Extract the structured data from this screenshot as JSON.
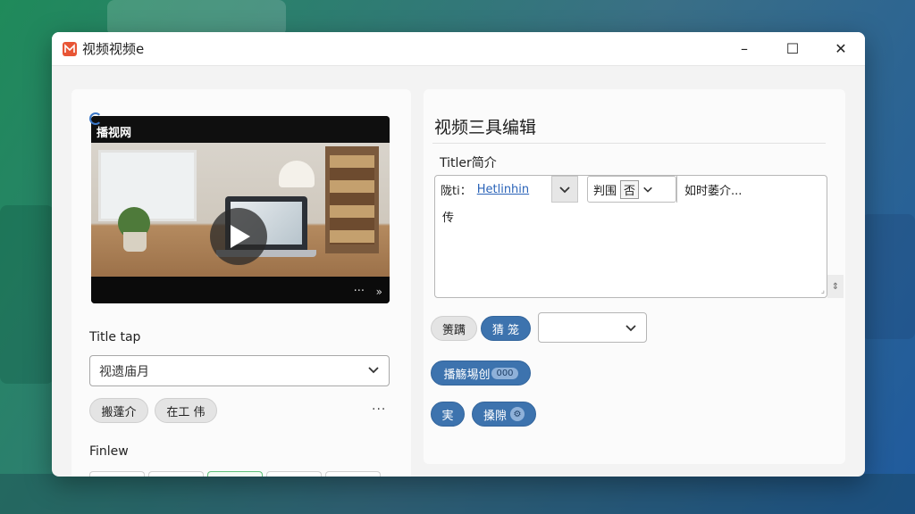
{
  "window": {
    "title": "视频视频e",
    "minimize": "–",
    "maximize": "☐",
    "close": "✕"
  },
  "left": {
    "video": {
      "title": "播视网",
      "more": "···",
      "expand": "»"
    },
    "title_tap_label": "Title tap",
    "dropdown": {
      "value": "视遗庙月"
    },
    "chips": [
      "搬蓬介",
      "在工 伟"
    ],
    "more": "···",
    "finlew_label": "Finlew"
  },
  "right": {
    "heading": "视频三具编辑",
    "titler_label": "Titler简介",
    "editor": {
      "seg1_prefix": "陇ti：",
      "seg1_link": "Hetlinhin",
      "seg2_text": "判围",
      "seg2_box": "否",
      "seg3_text": "如时萎介...",
      "body": "传"
    },
    "buttons": {
      "row1_a": "箦蹒",
      "row1_b": "猜 笼",
      "row2": "播觞埸创",
      "row2_badge": "000",
      "row3_a": "実",
      "row3_b": "搡隙"
    }
  },
  "colors": {
    "accent_blue": "#3d73ae",
    "link_blue": "#2a63b8",
    "app_icon": "#e85535"
  }
}
